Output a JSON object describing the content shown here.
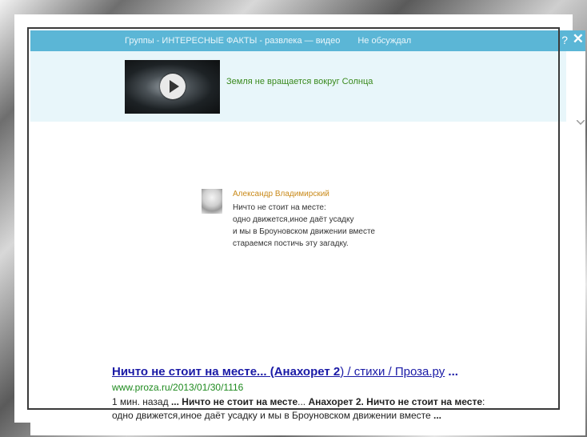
{
  "top_bar": {
    "title": "Группы - ИНТЕРЕСНЫЕ ФАКТЫ - развлека — видео",
    "subtitle": "Не обсуждал",
    "help_label": "?",
    "close_label": "✕"
  },
  "video": {
    "title": "Земля не вращается вокруг Солнца",
    "play_icon": "play-icon"
  },
  "quote": {
    "author": "Александр Владимирский",
    "lines": [
      "Ничто не стоит на месте:",
      "одно движется,иное даёт усадку",
      "и мы в Броуновском движении вместе",
      "стараемся постичь эту загадку."
    ]
  },
  "result": {
    "title_part1": "Ничто не стоит на месте... (Анахорет 2",
    "title_part2": ") / стихи / Проза.ру",
    "title_part3": "...",
    "url": "www.proza.ru/2013/01/30/1116",
    "snippet_time": "1 мин. назад",
    "snippet_b1": "... Ничто не стоит на месте",
    "snippet_t1": "... ",
    "snippet_b2": "Анахорет 2. Ничто не стоит на месте",
    "snippet_t2": ":",
    "snippet_line2": "одно движется,иное даёт усадку и мы в Броуновском движении вместе",
    "snippet_end": "..."
  },
  "colors": {
    "top_bar": "#5bb6d6",
    "video_panel": "#e8f6fa",
    "link": "#1a1aa6",
    "url": "#1e8a1e",
    "author": "#c98a1a"
  }
}
